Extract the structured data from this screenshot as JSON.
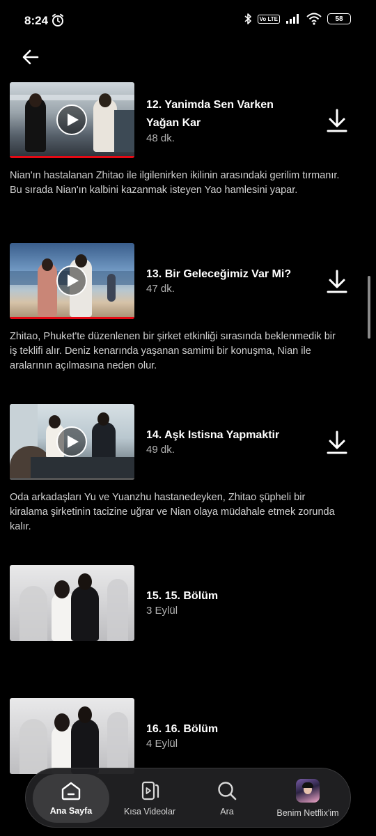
{
  "status_bar": {
    "time": "8:24",
    "battery": "58",
    "volte": "Vo LTE"
  },
  "episodes": [
    {
      "title": "12. Yanimda Sen Varken Yağan Kar",
      "meta": "48 dk.",
      "description": "Nian'ın hastalanan Zhitao ile ilgilenirken ikilinin arasındaki gerilim tırmanır. Bu sırada Nian'ın kalbini kazanmak isteyen Yao hamlesini yapar.",
      "progress": 1.0,
      "downloadable": true
    },
    {
      "title": "13. Bir Geleceğimiz Var Mi?",
      "meta": "47 dk.",
      "description": "Zhitao, Phuket'te düzenlenen bir şirket etkinliği sırasında beklenmedik bir iş teklifi alır. Deniz kenarında yaşanan samimi bir konuşma, Nian ile aralarının açılmasına neden olur.",
      "progress": 1.0,
      "downloadable": true
    },
    {
      "title": "14. Aşk Istisna Yapmaktir",
      "meta": "49 dk.",
      "description": "Oda arkadaşları Yu ve Yuanzhu hastanedeyken, Zhitao şüpheli bir kiralama şirketinin tacizine uğrar ve Nian olaya müdahale etmek zorunda kalır.",
      "progress": 0.0,
      "downloadable": true
    },
    {
      "title": "15. 15. Bölüm",
      "meta": "3 Eylül",
      "description": "",
      "progress": 0.0,
      "downloadable": false
    },
    {
      "title": "16. 16. Bölüm",
      "meta": "4 Eylül",
      "description": "",
      "progress": 0.0,
      "downloadable": false
    }
  ],
  "bottom_nav": {
    "items": [
      {
        "label": "Ana Sayfa",
        "icon": "home-icon",
        "active": true
      },
      {
        "label": "Kısa Videolar",
        "icon": "clips-icon",
        "active": false
      },
      {
        "label": "Ara",
        "icon": "search-icon",
        "active": false
      },
      {
        "label": "Benim Netflix'im",
        "icon": "profile-avatar",
        "active": false
      }
    ]
  },
  "colors": {
    "background": "#000000",
    "accent": "#e50914",
    "nav_bg": "#202022",
    "muted_text": "#b3b3b3"
  }
}
